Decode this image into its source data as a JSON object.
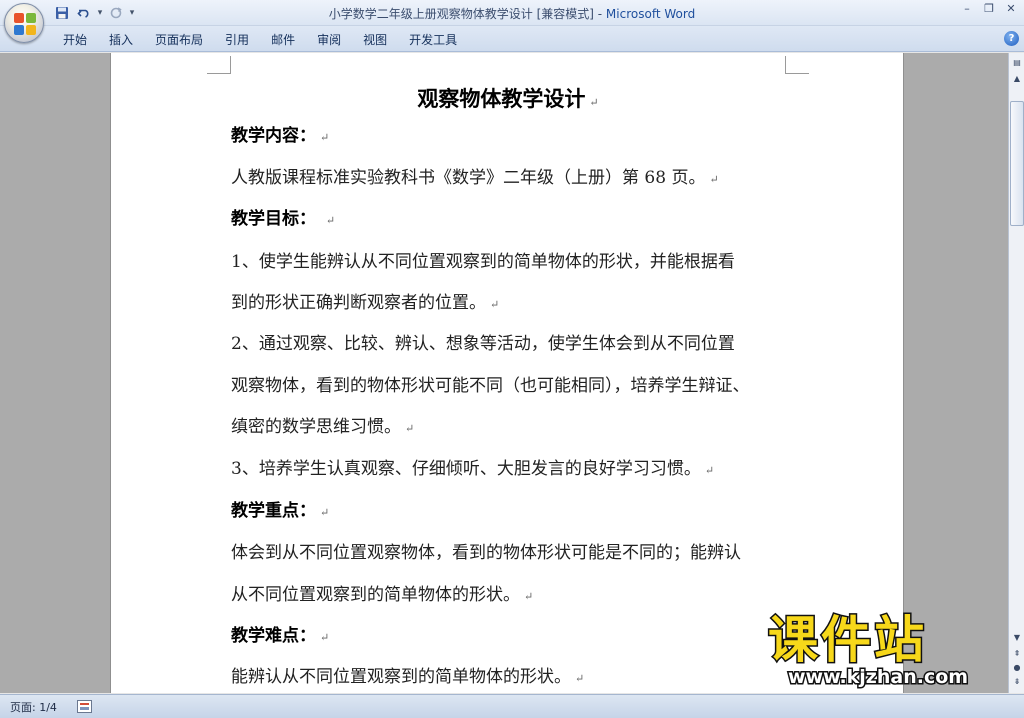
{
  "window": {
    "title_doc": "小学数学二年级上册观察物体教学设计 [兼容模式] - ",
    "title_app": "Microsoft Word"
  },
  "quick_access": {
    "save_icon": "save-icon",
    "undo_icon": "undo-icon",
    "redo_icon": "redo-icon",
    "customize_icon": "customize-qat-icon"
  },
  "ribbon": {
    "tabs": [
      "开始",
      "插入",
      "页面布局",
      "引用",
      "邮件",
      "审阅",
      "视图",
      "开发工具"
    ],
    "help_label": "?"
  },
  "document": {
    "title": "观察物体教学设计",
    "paragraph_mark": "↵",
    "lines": [
      {
        "text": "教学内容：",
        "bold": true
      },
      {
        "text": "人教版课程标准实验教科书《数学》二年级（上册）第 68 页。",
        "bold": false
      },
      {
        "text": "教学目标： ",
        "bold": true
      },
      {
        "text": "1、使学生能辨认从不同位置观察到的简单物体的形状，并能根据看",
        "bold": false
      },
      {
        "text": "到的形状正确判断观察者的位置。",
        "bold": false
      },
      {
        "text": "2、通过观察、比较、辨认、想象等活动，使学生体会到从不同位置",
        "bold": false
      },
      {
        "text": "观察物体，看到的物体形状可能不同（也可能相同），培养学生辩证、",
        "bold": false
      },
      {
        "text": "缜密的数学思维习惯。",
        "bold": false
      },
      {
        "text": "3、培养学生认真观察、仔细倾听、大胆发言的良好学习习惯。",
        "bold": false
      },
      {
        "text": "教学重点：",
        "bold": true
      },
      {
        "text": "体会到从不同位置观察物体，看到的物体形状可能是不同的；能辨认",
        "bold": false
      },
      {
        "text": "从不同位置观察到的简单物体的形状。",
        "bold": false
      },
      {
        "text": "教学难点：",
        "bold": true
      },
      {
        "text": "能辨认从不同位置观察到的简单物体的形状。",
        "bold": false
      }
    ]
  },
  "watermark": {
    "name": "课件站",
    "url": "www.kjzhan.com"
  },
  "statusbar": {
    "page": "页面: 1/4"
  },
  "colors": {
    "ribbon_bg": "#dbe5f3",
    "app_title": "#1f4f9d",
    "watermark_yellow": "#f7d81a"
  }
}
